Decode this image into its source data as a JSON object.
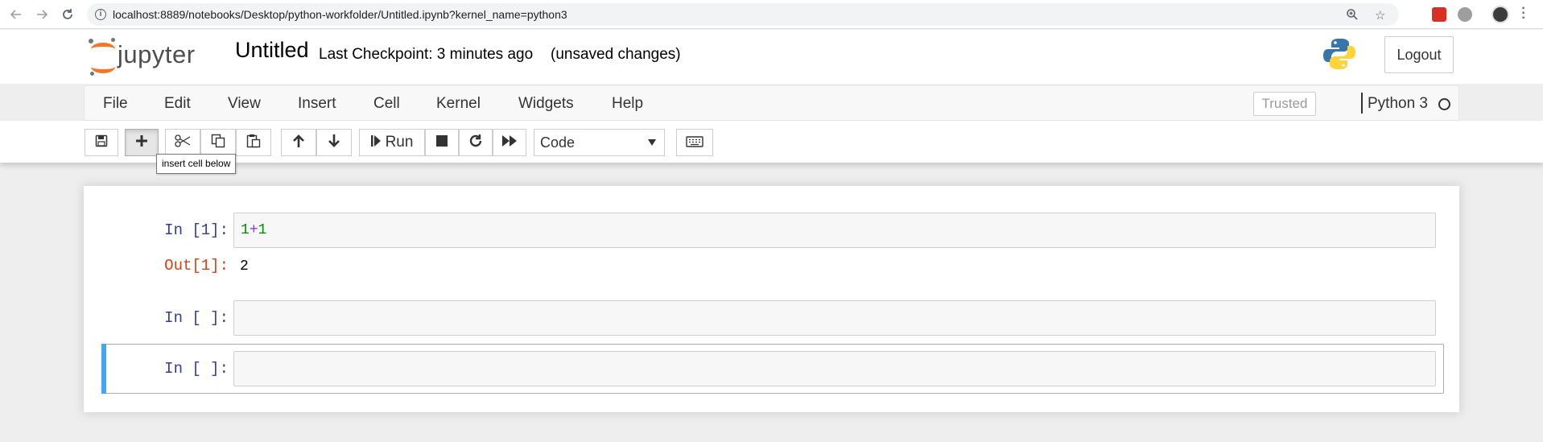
{
  "browser": {
    "url": "localhost:8889/notebooks/Desktop/python-workfolder/Untitled.ipynb?kernel_name=python3",
    "icons": [
      "back-arrow-icon",
      "forward-arrow-icon",
      "reload-icon",
      "info-icon",
      "zoom-icon",
      "star-icon",
      "extension-icon",
      "profile-avatar",
      "more-icon"
    ]
  },
  "header": {
    "logo_text": "jupyter",
    "notebook_name": "Untitled",
    "checkpoint": "Last Checkpoint: 3 minutes ago",
    "save_status": "(unsaved changes)",
    "logout_label": "Logout"
  },
  "menubar": {
    "items": [
      "File",
      "Edit",
      "View",
      "Insert",
      "Cell",
      "Kernel",
      "Widgets",
      "Help"
    ],
    "trusted_label": "Trusted",
    "kernel_name": "Python 3"
  },
  "toolbar": {
    "run_label": "Run",
    "cell_type": "Code",
    "tooltip": "insert cell below"
  },
  "cells": [
    {
      "prompt": "In [1]:",
      "code_left": "1",
      "code_op": "+",
      "code_right": "1",
      "out_prompt": "Out[1]:",
      "output": "2"
    },
    {
      "prompt": "In [ ]:"
    },
    {
      "prompt": "In [ ]:"
    }
  ],
  "colors": {
    "in_prompt": "#303f9f",
    "out_prompt": "#d84315",
    "selected_cell_bar": "#42a5f5",
    "jupyter_orange": "#f37726"
  }
}
